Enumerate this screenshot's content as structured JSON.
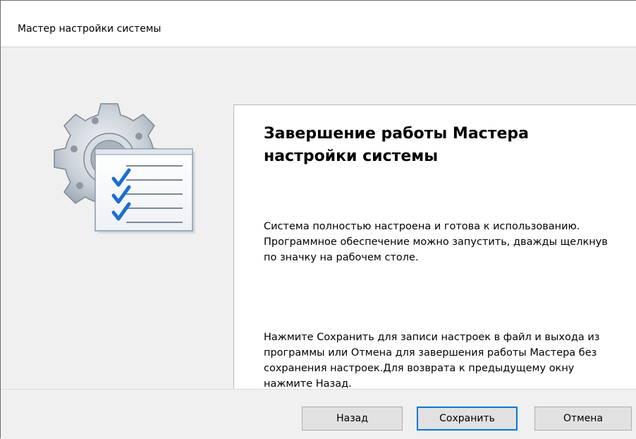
{
  "window": {
    "title": "Мастер настройки системы"
  },
  "illustration": {
    "icon": "settings-checklist-icon"
  },
  "content": {
    "heading": "Завершение работы Мастера настройки системы",
    "paragraph1": "Система полностью настроена и готова к использованию. Программное обеспечение можно запустить, дважды щелкнув по значку на рабочем столе.",
    "paragraph2": "Нажмите Сохранить для записи настроек в файл и выхода из программы или Отмена для завершения работы Мастера без сохранения настроек.Для возврата к предыдущему окну нажмите Назад."
  },
  "buttons": {
    "back": "Назад",
    "save": "Сохранить",
    "cancel": "Отмена"
  },
  "colors": {
    "accent": "#0078d7",
    "checkmark": "#1a6fd0",
    "background": "#f0f0f0"
  }
}
